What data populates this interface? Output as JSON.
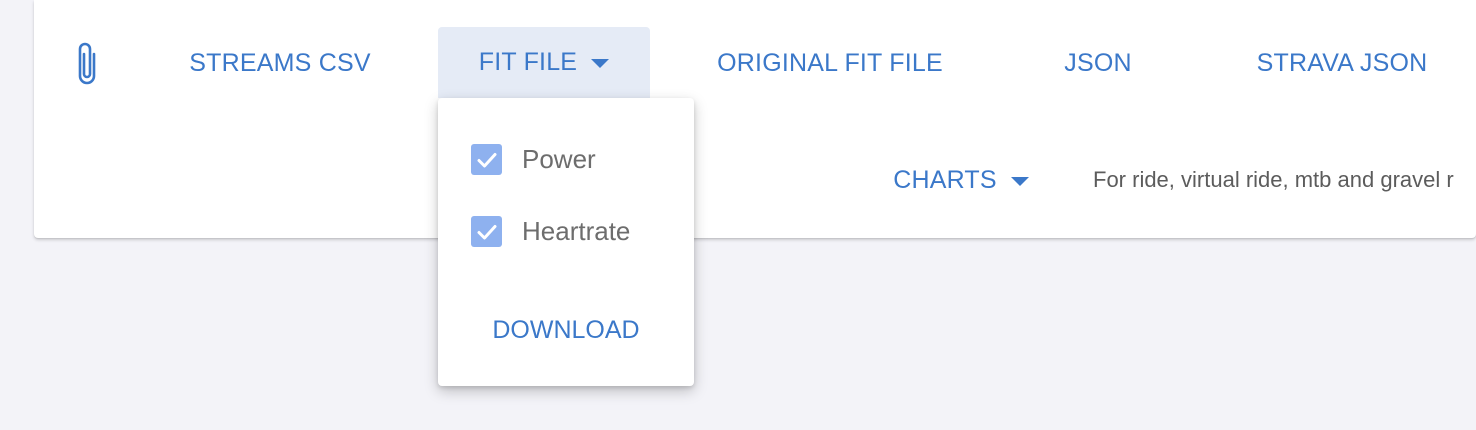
{
  "toolbar": {
    "streams_csv": "STREAMS CSV",
    "fit_file": "FIT FILE",
    "original_fit_file": "ORIGINAL FIT FILE",
    "json": "JSON",
    "strava_json": "STRAVA JSON",
    "charts": "CHARTS",
    "charts_description": "For ride, virtual ride, mtb and gravel r"
  },
  "fit_menu": {
    "options": [
      {
        "label": "Power",
        "checked": true
      },
      {
        "label": "Heartrate",
        "checked": true
      }
    ],
    "download_label": "DOWNLOAD"
  },
  "icons": {
    "attachment": "paperclip-icon",
    "dropdown": "caret-down-icon",
    "checkbox": "check-icon"
  },
  "colors": {
    "accent": "#3b78c9",
    "active_button_bg": "#e5ebf6",
    "checkbox_fill": "#8eb1ef",
    "page_bg": "#f3f3f8"
  }
}
